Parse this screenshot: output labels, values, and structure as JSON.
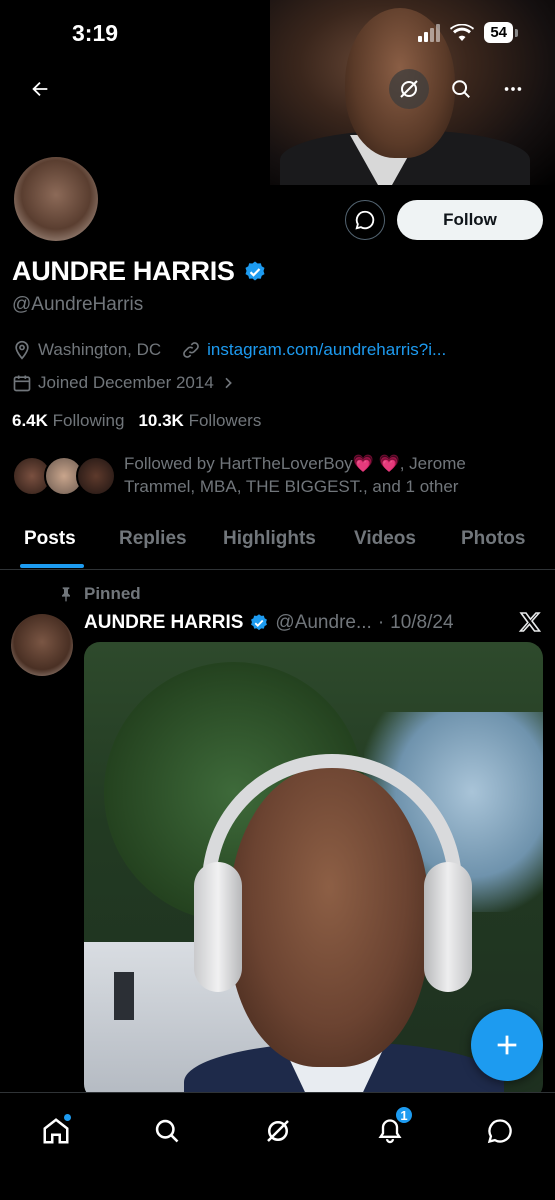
{
  "status_bar": {
    "time": "3:19",
    "battery": "54"
  },
  "profile": {
    "display_name": "AUNDRE HARRIS",
    "handle": "@AundreHarris",
    "location": "Washington, DC",
    "website": "instagram.com/aundreharris?i...",
    "joined": "Joined December 2014",
    "following_count": "6.4K",
    "following_label": "Following",
    "followers_count": "10.3K",
    "followers_label": "Followers",
    "followed_by_line1": "Followed by HartTheLoverBoy💗 💗, Jerome",
    "followed_by_line2": "Trammel, MBA, THE BIGGEST., and 1 other",
    "follow_button": "Follow"
  },
  "tabs": [
    "Posts",
    "Replies",
    "Highlights",
    "Videos",
    "Photos"
  ],
  "post": {
    "pinned_label": "Pinned",
    "author_name": "AUNDRE HARRIS",
    "author_handle": "@Aundre...",
    "separator": "·",
    "date": "10/8/24"
  },
  "nav": {
    "notifications_badge": "1"
  },
  "colors": {
    "accent": "#1d9bf0",
    "background": "#000000",
    "muted": "#71767b"
  }
}
